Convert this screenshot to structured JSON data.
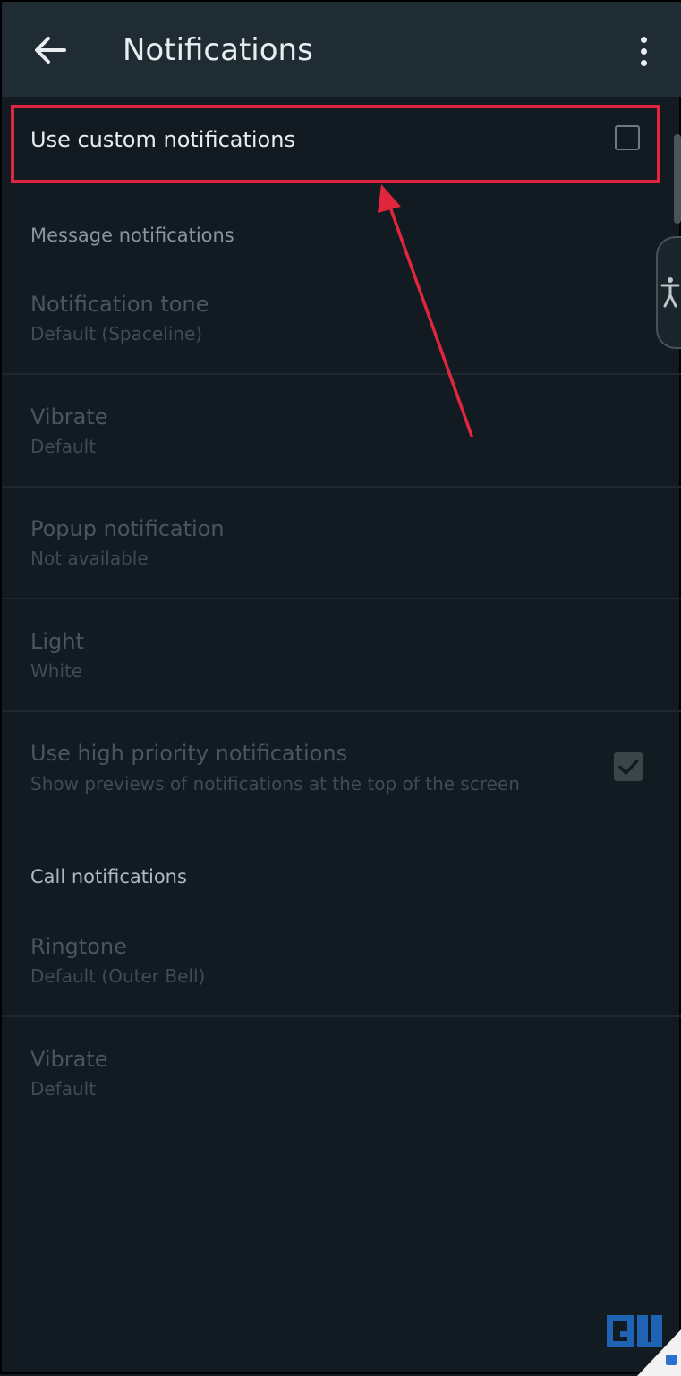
{
  "app_bar": {
    "title": "Notifications",
    "back_icon": "arrow-left-icon",
    "menu_icon": "more-vert-icon"
  },
  "custom_notifications": {
    "label": "Use custom notifications",
    "checked": false
  },
  "message_section": {
    "header": "Message notifications",
    "items": [
      {
        "title": "Notification tone",
        "subtitle": "Default (Spaceline)"
      },
      {
        "title": "Vibrate",
        "subtitle": "Default"
      },
      {
        "title": "Popup notification",
        "subtitle": "Not available"
      },
      {
        "title": "Light",
        "subtitle": "White"
      }
    ],
    "high_priority": {
      "title": "Use high priority notifications",
      "subtitle": "Show previews of notifications at the top of the screen",
      "checked": true
    }
  },
  "call_section": {
    "header": "Call notifications",
    "items": [
      {
        "title": "Ringtone",
        "subtitle": "Default (Outer Bell)"
      },
      {
        "title": "Vibrate",
        "subtitle": "Default"
      }
    ]
  },
  "colors": {
    "background": "#121b22",
    "app_bar": "#1f2c34",
    "highlight": "#e0263d"
  }
}
